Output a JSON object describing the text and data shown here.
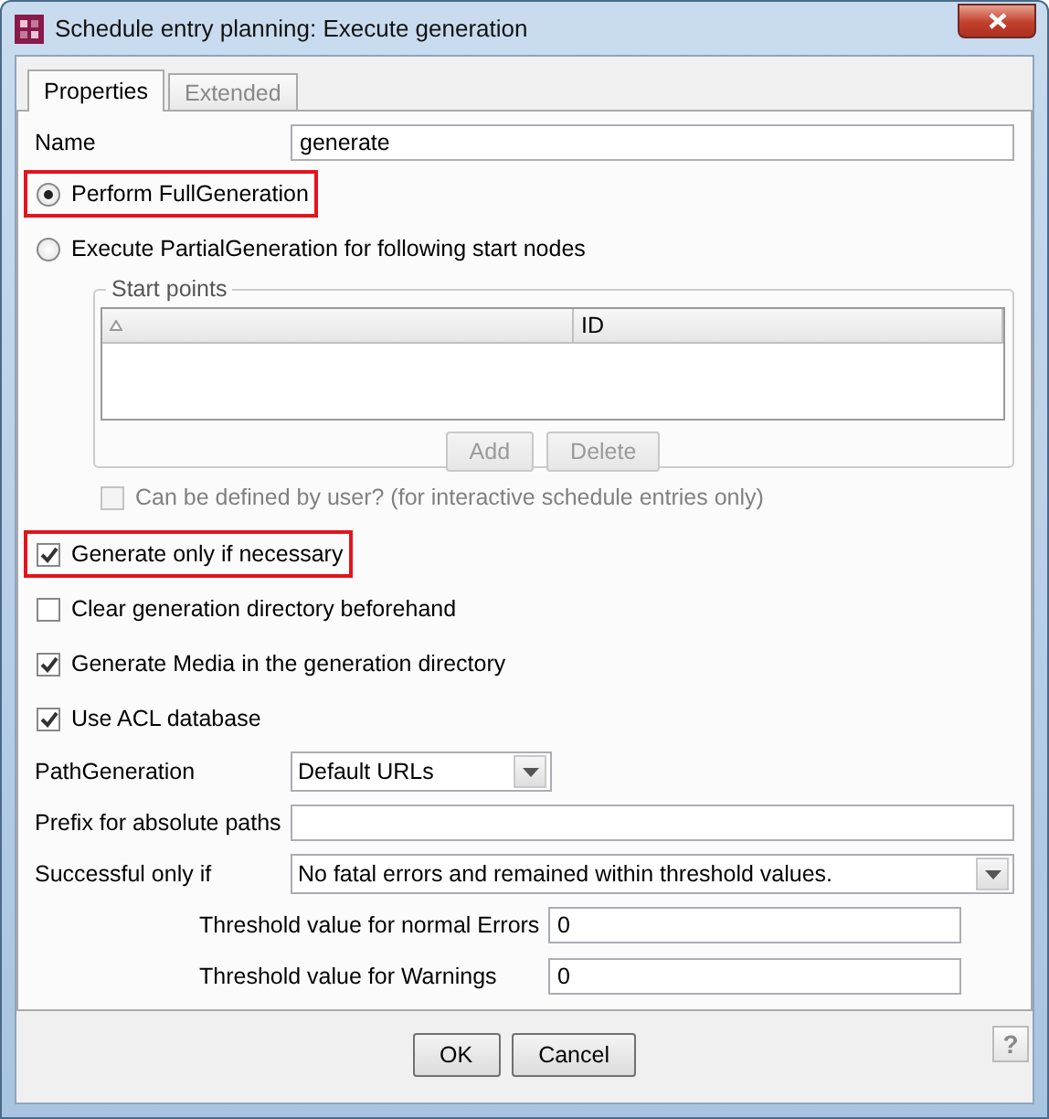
{
  "window": {
    "title": "Schedule entry planning: Execute generation"
  },
  "tabs": [
    {
      "label": "Properties",
      "selected": true
    },
    {
      "label": "Extended",
      "selected": false
    }
  ],
  "name_field": {
    "label": "Name",
    "value": "generate"
  },
  "generation_mode": [
    {
      "label": "Perform FullGeneration",
      "selected": true,
      "highlighted": true
    },
    {
      "label": "Execute PartialGeneration for following start nodes",
      "selected": false,
      "highlighted": false
    }
  ],
  "start_points": {
    "title": "Start points",
    "columns": [
      {
        "sorted": true
      },
      {
        "label": "ID",
        "sorted": false
      }
    ],
    "buttons": [
      {
        "label": "Add",
        "disabled": true
      },
      {
        "label": "Delete",
        "disabled": true
      }
    ]
  },
  "user_defined": {
    "label": "Can be defined by user? (for interactive schedule entries only)",
    "checked": false,
    "disabled": true
  },
  "options": [
    {
      "label": "Generate only if necessary",
      "checked": true,
      "highlighted": true
    },
    {
      "label": "Clear generation directory beforehand",
      "checked": false,
      "highlighted": false
    },
    {
      "label": "Generate Media in the generation directory",
      "checked": true,
      "highlighted": false
    },
    {
      "label": "Use ACL database",
      "checked": true,
      "highlighted": false
    }
  ],
  "path_generation": {
    "label": "PathGeneration",
    "value": "Default URLs"
  },
  "prefix": {
    "label": "Prefix for absolute paths"
  },
  "success": {
    "label": "Successful only if",
    "value": "No fatal errors and remained within threshold values."
  },
  "thresholds": [
    {
      "label": "Threshold value for normal Errors",
      "value": "0"
    },
    {
      "label": "Threshold value for Warnings",
      "value": "0"
    }
  ],
  "buttons": [
    {
      "label": "OK"
    },
    {
      "label": "Cancel"
    }
  ],
  "help": "?"
}
